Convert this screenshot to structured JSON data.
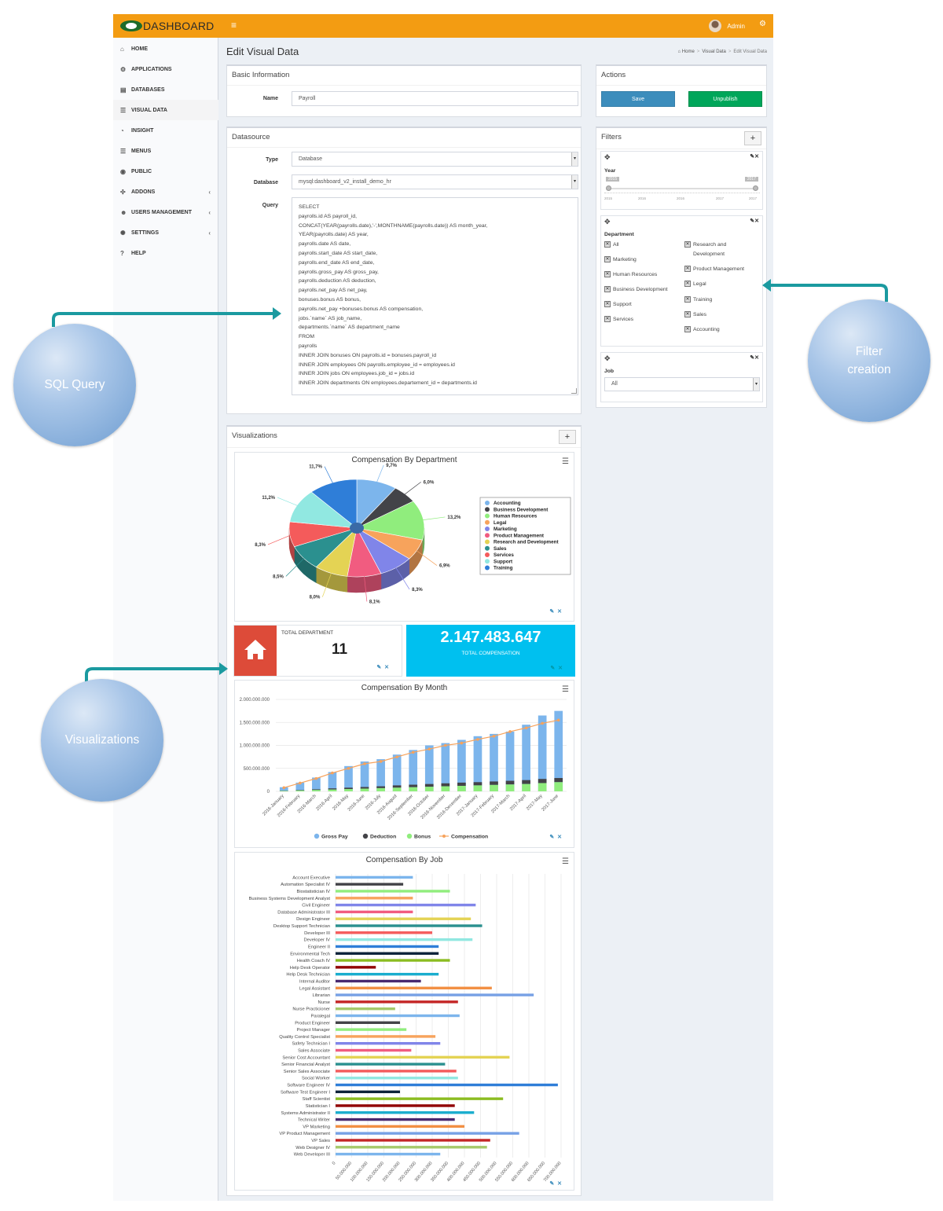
{
  "header": {
    "brand": "DASHBOARD",
    "menu_icon": "≡",
    "user_name": "Admin"
  },
  "sidebar": {
    "items": [
      {
        "label": "HOME",
        "icon": "home-icon",
        "glyph": "⌂"
      },
      {
        "label": "APPLICATIONS",
        "icon": "cubes-icon",
        "glyph": "⚙"
      },
      {
        "label": "DATABASES",
        "icon": "database-icon",
        "glyph": "▤"
      },
      {
        "label": "VISUAL DATA",
        "icon": "table-icon",
        "glyph": "☰"
      },
      {
        "label": "INSIGHT",
        "icon": "dashboard-icon",
        "glyph": "◔"
      },
      {
        "label": "MENUS",
        "icon": "list-icon",
        "glyph": "☰"
      },
      {
        "label": "PUBLIC",
        "icon": "eye-icon",
        "glyph": "◉"
      },
      {
        "label": "ADDONS",
        "icon": "puzzle-icon",
        "glyph": "✣",
        "chevron": "‹"
      },
      {
        "label": "USERS MANAGEMENT",
        "icon": "users-icon",
        "glyph": "☻",
        "chevron": "‹"
      },
      {
        "label": "SETTINGS",
        "icon": "gear-icon",
        "glyph": "✺",
        "chevron": "‹"
      },
      {
        "label": "HELP",
        "icon": "question-icon",
        "glyph": "?"
      }
    ]
  },
  "page": {
    "title": "Edit Visual Data",
    "breadcrumb": [
      "Home",
      "Visual Data",
      "Edit Visual Data"
    ]
  },
  "basic_info": {
    "title": "Basic Information",
    "name_label": "Name",
    "name_value": "Payroll"
  },
  "datasource": {
    "title": "Datasource",
    "type_label": "Type",
    "type_value": "Database",
    "database_label": "Database",
    "database_value": "mysql:dashboard_v2_install_demo_hr",
    "query_label": "Query",
    "query": "SELECT\npayrolls.id AS payroll_id,\nCONCAT(YEAR(payrolls.date),'-',MONTHNAME(payrolls.date)) AS month_year,\nYEAR(payrolls.date) AS year,\npayrolls.date AS date,\npayrolls.start_date AS start_date,\npayrolls.end_date AS end_date,\npayrolls.gross_pay AS gross_pay,\npayrolls.deduction AS deduction,\npayrolls.net_pay AS net_pay,\nbonuses.bonus AS bonus,\npayrolls.net_pay +bonuses.bonus AS compensation,\njobs.`name` AS job_name,\ndepartments.`name` AS department_name\nFROM\npayrolls\nINNER JOIN bonuses ON payrolls.id = bonuses.payroll_id\nINNER JOIN employees ON payrolls.employee_id = employees.id\nINNER JOIN jobs ON employees.job_id = jobs.id\nINNER JOIN departments ON employees.departement_id = departments.id"
  },
  "actions": {
    "title": "Actions",
    "save_label": "Save",
    "unpublish_label": "Unpublish"
  },
  "filters": {
    "title": "Filters",
    "year": {
      "label": "Year",
      "min_label": "2015",
      "max_label": "2017",
      "ticks": [
        "2015",
        "2016",
        "2016",
        "2017",
        "2017"
      ]
    },
    "department": {
      "label": "Department",
      "col1": [
        "All",
        "Marketing",
        "Human Resources",
        "Business Development",
        "Support",
        "Services"
      ],
      "col2": [
        "Research and\nDevelopment",
        "Product Management",
        "Legal",
        "Training",
        "Sales",
        "Accounting"
      ]
    },
    "job": {
      "label": "Job",
      "value": "All"
    }
  },
  "visualizations": {
    "title": "Visualizations",
    "total_department": {
      "label": "TOTAL DEPARTMENT",
      "value": "11"
    },
    "total_compensation": {
      "label": "TOTAL COMPENSATION",
      "value": "2.147.483.647"
    }
  },
  "annotations": {
    "sql": "SQL Query",
    "filter": "Filter\ncreation",
    "viz": "Visualizations"
  },
  "colors": {
    "orange": "#f39c12",
    "blue_btn": "#3c8dbc",
    "green_btn": "#00a65a",
    "red_box": "#dd4b39",
    "aqua_box": "#00c0ef",
    "teal_arrow": "#1b9aa0"
  },
  "chart_data": [
    {
      "type": "pie",
      "title": "Compensation By Department",
      "series": [
        {
          "values": [
            {
              "name": "Accounting",
              "value": 9.7,
              "label": "9,7%",
              "color": "#7cb5ec"
            },
            {
              "name": "Business Development",
              "value": 6.0,
              "label": "6,0%",
              "color": "#434348"
            },
            {
              "name": "Human Resources",
              "value": 13.2,
              "label": "13,2%",
              "color": "#90ed7d"
            },
            {
              "name": "Legal",
              "value": 6.9,
              "label": "6,9%",
              "color": "#f7a35c"
            },
            {
              "name": "Marketing",
              "value": 8.3,
              "label": "8,3%",
              "color": "#8085e9"
            },
            {
              "name": "Product Management",
              "value": 8.1,
              "label": "8,1%",
              "color": "#f15c80"
            },
            {
              "name": "Research and Development",
              "value": 8.0,
              "label": "8,0%",
              "color": "#e4d354"
            },
            {
              "name": "Sales",
              "value": 8.5,
              "label": "8,5%",
              "color": "#2b908f"
            },
            {
              "name": "Services",
              "value": 8.3,
              "label": "8,3%",
              "color": "#f45b5b"
            },
            {
              "name": "Support",
              "value": 11.2,
              "label": "11,2%",
              "color": "#91e8e1"
            },
            {
              "name": "Training",
              "value": 11.7,
              "label": "11,7%",
              "color": "#2f7ed8"
            }
          ]
        }
      ],
      "legend": "right"
    },
    {
      "type": "bar",
      "title": "Compensation By Month",
      "categories": [
        "2016-January",
        "2016-February",
        "2016-March",
        "2016-April",
        "2016-May",
        "2016-June",
        "2016-July",
        "2016-August",
        "2016-September",
        "2016-October",
        "2016-November",
        "2016-December",
        "2017-January",
        "2017-February",
        "2017-March",
        "2017-April",
        "2017-May",
        "2017-June"
      ],
      "series": [
        {
          "name": "Gross Pay",
          "color": "#7cb5ec",
          "values": [
            90000000,
            190000000,
            300000000,
            420000000,
            550000000,
            650000000,
            700000000,
            800000000,
            900000000,
            1000000000,
            1050000000,
            1120000000,
            1200000000,
            1250000000,
            1300000000,
            1450000000,
            1650000000,
            1750000000
          ]
        },
        {
          "name": "Deduction",
          "color": "#434348",
          "values": [
            5000000,
            10000000,
            15000000,
            25000000,
            30000000,
            35000000,
            40000000,
            50000000,
            55000000,
            60000000,
            65000000,
            70000000,
            70000000,
            75000000,
            80000000,
            85000000,
            90000000,
            90000000
          ]
        },
        {
          "name": "Bonus",
          "color": "#90ed7d",
          "values": [
            10000000,
            20000000,
            30000000,
            40000000,
            50000000,
            60000000,
            70000000,
            80000000,
            90000000,
            100000000,
            110000000,
            120000000,
            130000000,
            140000000,
            150000000,
            160000000,
            180000000,
            200000000
          ]
        },
        {
          "name": "Compensation",
          "color": "#f7a35c",
          "type": "line",
          "values": [
            80000000,
            180000000,
            280000000,
            400000000,
            500000000,
            600000000,
            650000000,
            750000000,
            850000000,
            920000000,
            1000000000,
            1050000000,
            1130000000,
            1200000000,
            1300000000,
            1380000000,
            1480000000,
            1550000000
          ]
        }
      ],
      "ylim": [
        0,
        2000000000
      ],
      "yticks": [
        "0",
        "500.000.000",
        "1.000.000.000",
        "1.500.000.000",
        "2.000.000.000"
      ],
      "legend": "bottom"
    },
    {
      "type": "bar",
      "orientation": "horizontal",
      "title": "Compensation By Job",
      "categories": [
        "Account Executive",
        "Automation Specialist IV",
        "Biostatistician IV",
        "Business Systems Development Analyst",
        "Civil Engineer",
        "Database Administrator III",
        "Design Engineer",
        "Desktop Support Technician",
        "Developer III",
        "Developer IV",
        "Engineer II",
        "Environmental Tech",
        "Health Coach IV",
        "Help Desk Operator",
        "Help Desk Technician",
        "Internal Auditor",
        "Legal Assistant",
        "Librarian",
        "Nurse",
        "Nurse Practicioner",
        "Paralegal",
        "Product Engineer",
        "Project Manager",
        "Quality Control Specialist",
        "Safety Technician I",
        "Sales Associate",
        "Senior Cost Accountant",
        "Senior Financial Analyst",
        "Senior Sales Associate",
        "Social Worker",
        "Software Engineer IV",
        "Software Test Engineer I",
        "Staff Scientist",
        "Statistician I",
        "Systems Administrator II",
        "Technical Writer",
        "VP Marketing",
        "VP Product Management",
        "VP Sales",
        "Web Designer IV",
        "Web Developer III"
      ],
      "values": [
        240000000,
        210000000,
        355000000,
        240000000,
        435000000,
        240000000,
        420000000,
        455000000,
        300000000,
        425000000,
        320000000,
        320000000,
        355000000,
        125000000,
        320000000,
        265000000,
        485000000,
        615000000,
        380000000,
        185000000,
        385000000,
        200000000,
        220000000,
        310000000,
        325000000,
        235000000,
        540000000,
        340000000,
        375000000,
        380000000,
        690000000,
        200000000,
        520000000,
        370000000,
        430000000,
        370000000,
        400000000,
        570000000,
        480000000,
        470000000,
        325000000
      ],
      "colors": [
        "#7cb5ec",
        "#434348",
        "#90ed7d",
        "#f7a35c",
        "#8085e9",
        "#f15c80",
        "#e4d354",
        "#2b908f",
        "#f45b5b",
        "#91e8e1",
        "#2f7ed8",
        "#0d233a",
        "#8bbc21",
        "#910000",
        "#1aadce",
        "#492970",
        "#f28f43",
        "#77a1e5",
        "#c42525",
        "#a6c96a"
      ],
      "xlim": [
        0,
        700000000
      ],
      "xticks": [
        "0",
        "50.000.000",
        "100.000.000",
        "150.000.000",
        "200.000.000",
        "250.000.000",
        "300.000.000",
        "350.000.000",
        "400.000.000",
        "450.000.000",
        "500.000.000",
        "550.000.000",
        "600.000.000",
        "650.000.000",
        "700.000.000"
      ]
    }
  ]
}
